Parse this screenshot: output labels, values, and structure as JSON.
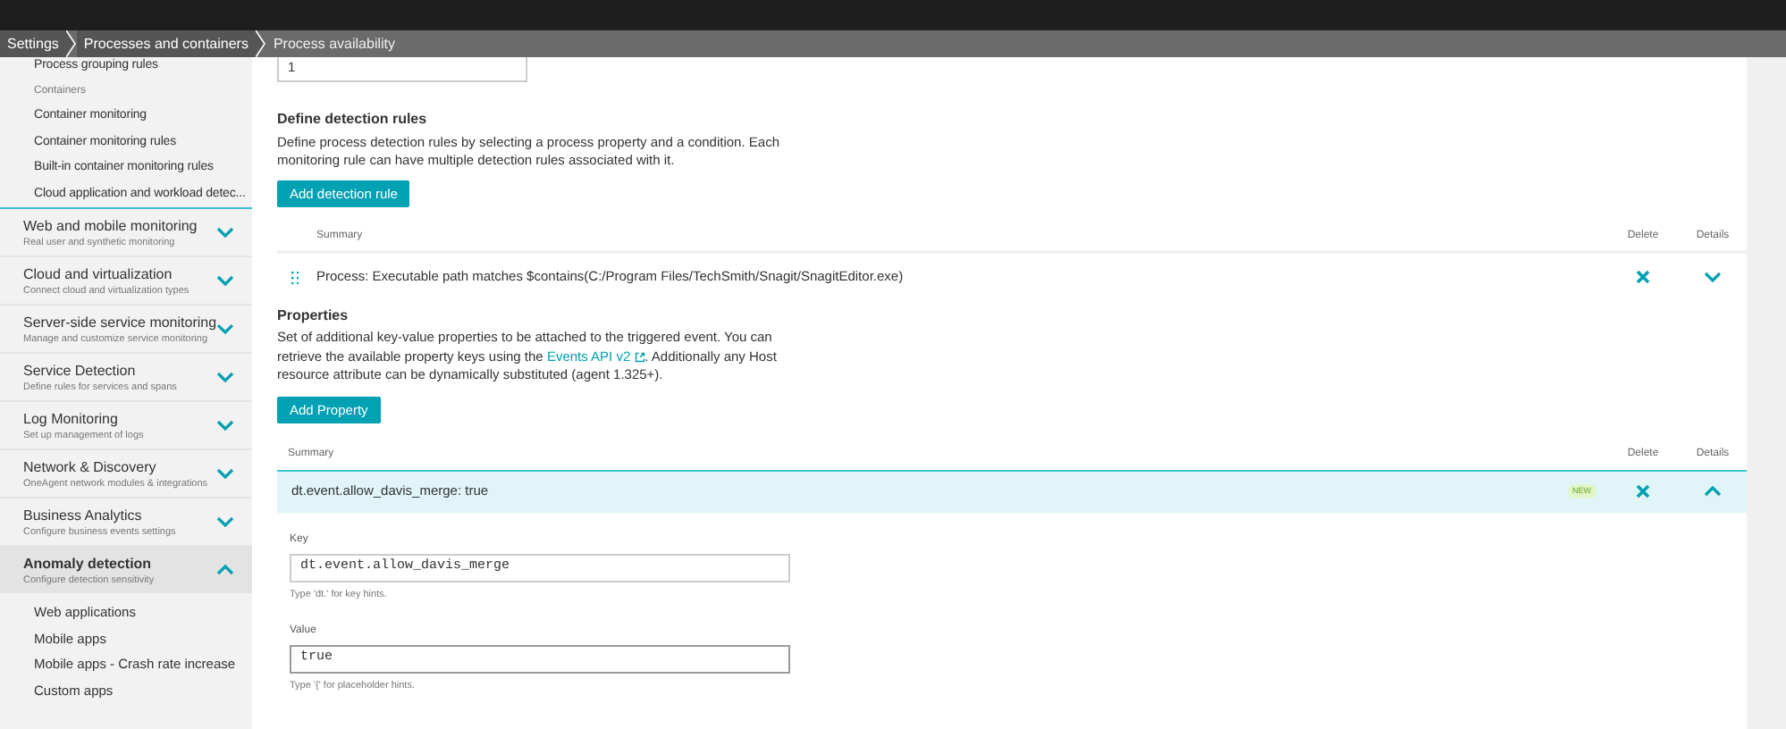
{
  "breadcrumbs": [
    {
      "label": "Settings"
    },
    {
      "label": "Processes and containers"
    },
    {
      "label": "Process availability"
    }
  ],
  "sidebar": {
    "items": [
      {
        "kind": "item",
        "label": "Process grouping rules"
      },
      {
        "kind": "heading",
        "label": "Containers"
      },
      {
        "kind": "item",
        "label": "Container monitoring"
      },
      {
        "kind": "item",
        "label": "Container monitoring rules"
      },
      {
        "kind": "item",
        "label": "Built-in container monitoring rules"
      },
      {
        "kind": "item",
        "label": "Cloud application and workload detec..."
      },
      {
        "kind": "group",
        "title": "Web and mobile monitoring",
        "subtitle": "Real user and synthetic monitoring",
        "expanded": false,
        "selected": false
      },
      {
        "kind": "group",
        "title": "Cloud and virtualization",
        "subtitle": "Connect cloud and virtualization types",
        "expanded": false,
        "selected": false
      },
      {
        "kind": "group",
        "title": "Server-side service monitoring",
        "subtitle": "Manage and customize service monitoring",
        "expanded": false,
        "selected": false
      },
      {
        "kind": "group",
        "title": "Service Detection",
        "subtitle": "Define rules for services and spans",
        "expanded": false,
        "selected": false
      },
      {
        "kind": "group",
        "title": "Log Monitoring",
        "subtitle": "Set up management of logs",
        "expanded": false,
        "selected": false
      },
      {
        "kind": "group",
        "title": "Network & Discovery",
        "subtitle": "OneAgent network modules & integrations",
        "expanded": false,
        "selected": false
      },
      {
        "kind": "group",
        "title": "Business Analytics",
        "subtitle": "Configure business events settings",
        "expanded": false,
        "selected": false
      },
      {
        "kind": "group",
        "title": "Anomaly detection",
        "subtitle": "Configure detection sensitivity",
        "expanded": true,
        "selected": true,
        "children": [
          {
            "label": "Web applications"
          },
          {
            "label": "Mobile apps"
          },
          {
            "label": "Mobile apps - Crash rate increase"
          },
          {
            "label": "Custom apps"
          }
        ]
      }
    ]
  },
  "main": {
    "top_field": {
      "value": "1"
    },
    "detection_rules": {
      "title": "Define detection rules",
      "description": "Define process detection rules by selecting a process property and a condition. Each monitoring rule can have multiple detection rules associated with it.",
      "button": "Add detection rule",
      "columns": [
        "Summary",
        "Delete",
        "Details"
      ],
      "rows": [
        {
          "summary": "Process: Executable path matches $contains(C:/Program Files/TechSmith/Snagit/SnagitEditor.exe)",
          "expanded": false
        }
      ]
    },
    "properties": {
      "title": "Properties",
      "description_before": "Set of additional key-value properties to be attached to the triggered event. You can retrieve the available property keys using the",
      "link": "Events API v2",
      "description_after": ". Additionally any Host resource attribute can be dynamically substituted (agent 1.325+).",
      "button": "Add Property",
      "columns": [
        "Summary",
        "Delete",
        "Details"
      ],
      "rows": [
        {
          "summary": "dt.event.allow_davis_merge: true",
          "badge": "NEW",
          "expanded": true,
          "fields": [
            {
              "label": "Key",
              "value": "dt.event.allow_davis_merge",
              "hint": "Type 'dt.' for key hints."
            },
            {
              "label": "Value",
              "value": "true",
              "hint": "Type '{' for placeholder hints."
            }
          ]
        }
      ]
    }
  }
}
